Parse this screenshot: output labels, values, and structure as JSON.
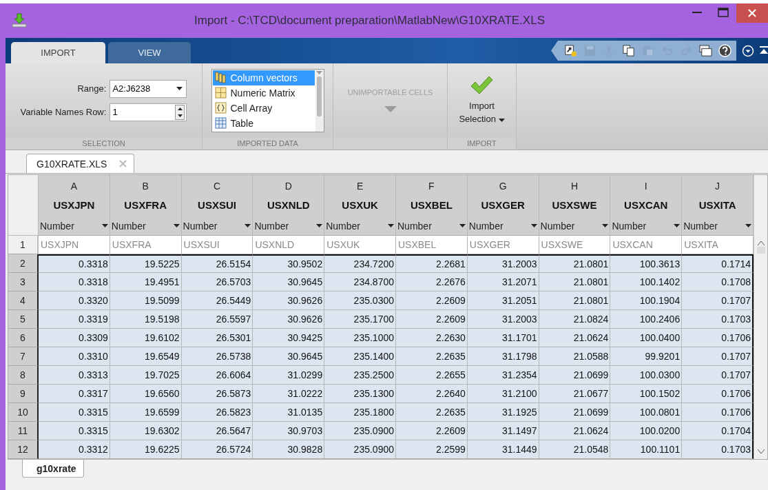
{
  "window": {
    "title": "Import - C:\\TCD\\document preparation\\MatlabNew\\G10XRATE.XLS"
  },
  "tabs": [
    {
      "label": "IMPORT",
      "selected": true
    },
    {
      "label": "VIEW",
      "selected": false
    }
  ],
  "quick_access": [
    {
      "kind": "new",
      "disabled": false
    },
    {
      "kind": "save",
      "disabled": true
    },
    {
      "kind": "cut",
      "disabled": true
    },
    {
      "kind": "copy",
      "disabled": false
    },
    {
      "kind": "paste",
      "disabled": true
    },
    {
      "kind": "undo",
      "disabled": true
    },
    {
      "kind": "redo",
      "disabled": true
    },
    {
      "kind": "windows",
      "disabled": false
    },
    {
      "kind": "help",
      "disabled": false
    }
  ],
  "ribbon": {
    "selection": {
      "label": "SELECTION",
      "range_label": "Range:",
      "range_value": "A2:J6238",
      "names_row_label": "Variable Names Row:",
      "names_row_value": "1"
    },
    "imported_data": {
      "label": "IMPORTED DATA",
      "options": [
        {
          "kind": "columns",
          "label": "Column vectors",
          "selected": true
        },
        {
          "kind": "matrix",
          "label": "Numeric Matrix",
          "selected": false
        },
        {
          "kind": "cell",
          "label": "Cell Array",
          "selected": false
        },
        {
          "kind": "table",
          "label": "Table",
          "selected": false
        }
      ]
    },
    "unimportable": {
      "label": "UNIMPORTABLE CELLS",
      "disabled": true
    },
    "import": {
      "label": "IMPORT",
      "button_lines": [
        "Import",
        "Selection"
      ]
    }
  },
  "document_tabs": [
    {
      "label": "G10XRATE.XLS",
      "selected": true
    }
  ],
  "table": {
    "columns": [
      {
        "letter": "A",
        "name": "USXJPN",
        "type": "Number"
      },
      {
        "letter": "B",
        "name": "USXFRA",
        "type": "Number"
      },
      {
        "letter": "C",
        "name": "USXSUI",
        "type": "Number"
      },
      {
        "letter": "D",
        "name": "USXNLD",
        "type": "Number"
      },
      {
        "letter": "E",
        "name": "USXUK",
        "type": "Number"
      },
      {
        "letter": "F",
        "name": "USXBEL",
        "type": "Number"
      },
      {
        "letter": "G",
        "name": "USXGER",
        "type": "Number"
      },
      {
        "letter": "H",
        "name": "USXSWE",
        "type": "Number"
      },
      {
        "letter": "I",
        "name": "USXCAN",
        "type": "Number"
      },
      {
        "letter": "J",
        "name": "USXITA",
        "type": "Number"
      }
    ],
    "rows": [
      {
        "number": "1",
        "selected": false,
        "cells": [
          "USXJPN",
          "USXFRA",
          "USXSUI",
          "USXNLD",
          "USXUK",
          "USXBEL",
          "USXGER",
          "USXSWE",
          "USXCAN",
          "USXITA"
        ]
      },
      {
        "number": "2",
        "selected": true,
        "cells": [
          "0.3318",
          "19.5225",
          "26.5154",
          "30.9502",
          "234.7200",
          "2.2681",
          "31.2003",
          "21.0801",
          "100.3613",
          "0.1714"
        ]
      },
      {
        "number": "3",
        "selected": true,
        "cells": [
          "0.3318",
          "19.4951",
          "26.5703",
          "30.9645",
          "234.8700",
          "2.2676",
          "31.2071",
          "21.0801",
          "100.1402",
          "0.1708"
        ]
      },
      {
        "number": "4",
        "selected": true,
        "cells": [
          "0.3320",
          "19.5099",
          "26.5449",
          "30.9626",
          "235.0300",
          "2.2609",
          "31.2051",
          "21.0801",
          "100.1904",
          "0.1707"
        ]
      },
      {
        "number": "5",
        "selected": true,
        "cells": [
          "0.3319",
          "19.5198",
          "26.5597",
          "30.9626",
          "235.1700",
          "2.2609",
          "31.2003",
          "21.0824",
          "100.2406",
          "0.1703"
        ]
      },
      {
        "number": "6",
        "selected": true,
        "cells": [
          "0.3309",
          "19.6102",
          "26.5301",
          "30.9425",
          "235.1000",
          "2.2630",
          "31.1701",
          "21.0624",
          "100.0400",
          "0.1706"
        ]
      },
      {
        "number": "7",
        "selected": true,
        "cells": [
          "0.3310",
          "19.6549",
          "26.5738",
          "30.9645",
          "235.1400",
          "2.2635",
          "31.1798",
          "21.0588",
          "99.9201",
          "0.1707"
        ]
      },
      {
        "number": "8",
        "selected": true,
        "cells": [
          "0.3313",
          "19.7025",
          "26.6064",
          "31.0299",
          "235.2500",
          "2.2655",
          "31.2354",
          "21.0699",
          "100.0300",
          "0.1707"
        ]
      },
      {
        "number": "9",
        "selected": true,
        "cells": [
          "0.3317",
          "19.6560",
          "26.5873",
          "31.0222",
          "235.1300",
          "2.2640",
          "31.2100",
          "21.0677",
          "100.1502",
          "0.1706"
        ]
      },
      {
        "number": "10",
        "selected": true,
        "cells": [
          "0.3315",
          "19.6599",
          "26.5823",
          "31.0135",
          "235.1800",
          "2.2635",
          "31.1925",
          "21.0699",
          "100.0801",
          "0.1706"
        ]
      },
      {
        "number": "11",
        "selected": true,
        "cells": [
          "0.3315",
          "19.6302",
          "26.5647",
          "30.9703",
          "235.0900",
          "2.2609",
          "31.1497",
          "21.0624",
          "100.0200",
          "0.1704"
        ]
      },
      {
        "number": "12",
        "selected": true,
        "cells": [
          "0.3312",
          "19.6225",
          "26.5724",
          "30.9828",
          "235.0900",
          "2.2599",
          "31.1449",
          "21.0548",
          "100.1101",
          "0.1703"
        ]
      }
    ]
  },
  "sheet_tabs": [
    {
      "label": "g10xrate",
      "selected": true
    }
  ]
}
